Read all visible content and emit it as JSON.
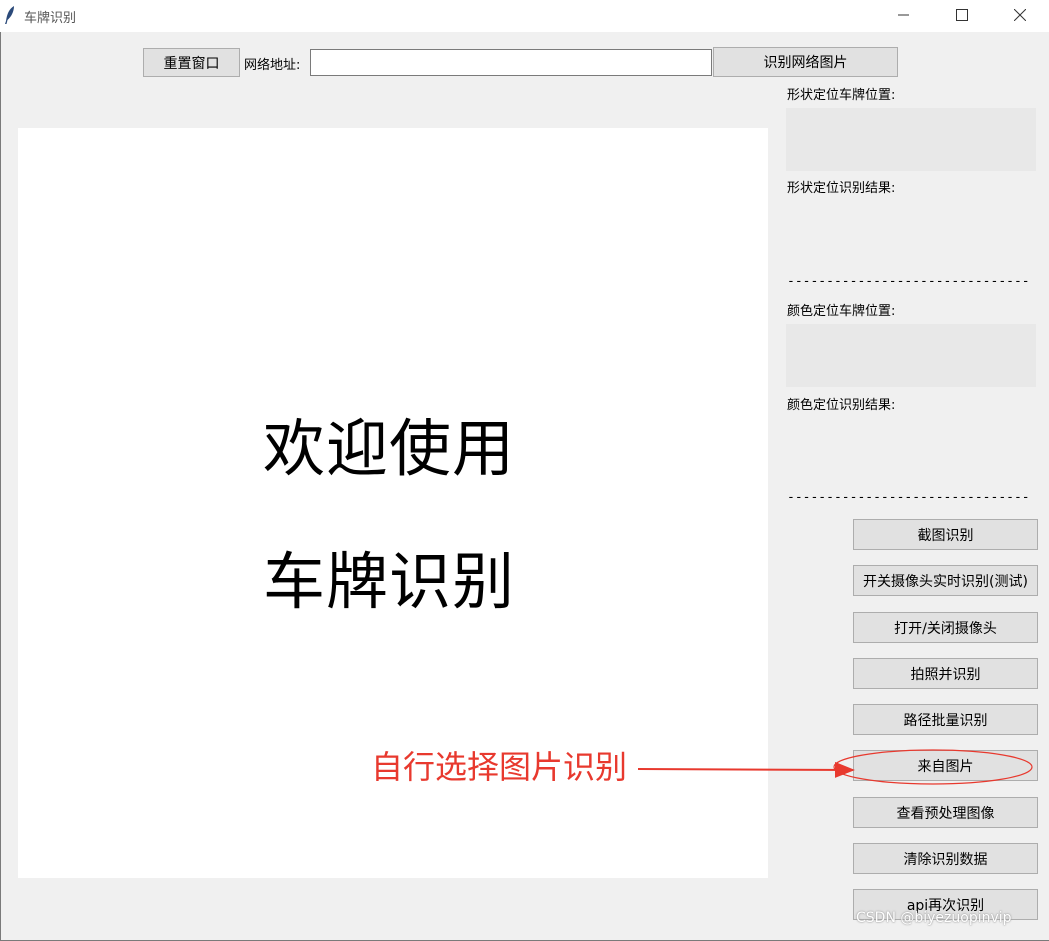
{
  "window": {
    "title": "车牌识别",
    "minimize_icon": "minimize-icon",
    "maximize_icon": "maximize-icon",
    "close_icon": "close-icon"
  },
  "toolbar": {
    "reset_label": "重置窗口",
    "url_label": "网络地址:",
    "url_value": "",
    "recognize_url_label": "识别网络图片"
  },
  "canvas": {
    "line1": "欢迎使用",
    "line2": "车牌识别"
  },
  "results": {
    "shape_position_label": "形状定位车牌位置:",
    "shape_result_label": "形状定位识别结果:",
    "divider": "-------------------------------",
    "color_position_label": "颜色定位车牌位置:",
    "color_result_label": "颜色定位识别结果:"
  },
  "actions": [
    {
      "label": "截图识别"
    },
    {
      "label": "开关摄像头实时识别(测试)"
    },
    {
      "label": "打开/关闭摄像头"
    },
    {
      "label": "拍照并识别"
    },
    {
      "label": "路径批量识别"
    },
    {
      "label": "来自图片"
    },
    {
      "label": "查看预处理图像"
    },
    {
      "label": "清除识别数据"
    },
    {
      "label": "api再次识别"
    }
  ],
  "annotation": {
    "text": "自行选择图片识别",
    "color": "#e8392e"
  },
  "watermark": "CSDN @biyezuopinvip"
}
